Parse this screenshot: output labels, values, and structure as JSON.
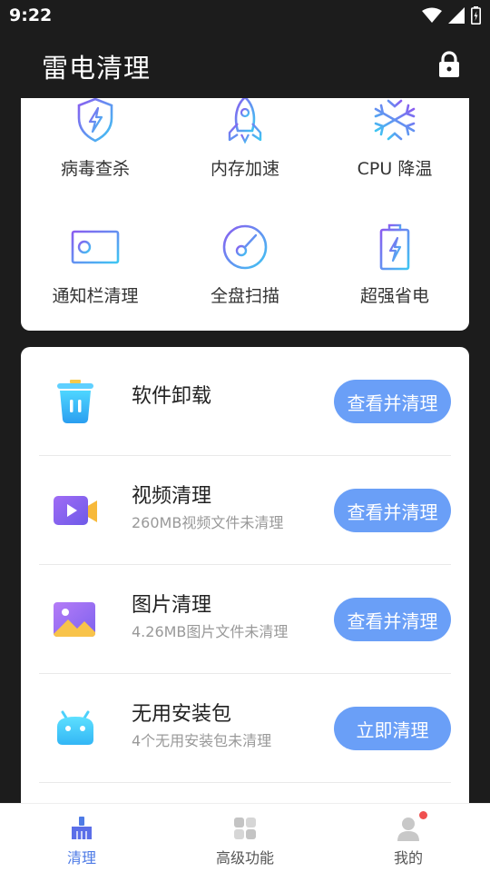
{
  "status_bar": {
    "time": "9:22"
  },
  "header": {
    "title": "雷电清理",
    "lock_icon": "lock-icon"
  },
  "grid": {
    "items": [
      {
        "label": "病毒查杀",
        "icon": "shield-lightning-icon"
      },
      {
        "label": "内存加速",
        "icon": "rocket-icon"
      },
      {
        "label": "CPU 降温",
        "icon": "snowflake-icon"
      },
      {
        "label": "通知栏清理",
        "icon": "id-card-icon"
      },
      {
        "label": "全盘扫描",
        "icon": "disc-scan-icon"
      },
      {
        "label": "超强省电",
        "icon": "battery-icon"
      }
    ]
  },
  "list": {
    "rows": [
      {
        "title": "软件卸载",
        "subtitle": "",
        "button": "查看并清理",
        "icon": "trash-icon"
      },
      {
        "title": "视频清理",
        "subtitle": "260MB视频文件未清理",
        "button": "查看并清理",
        "icon": "video-icon"
      },
      {
        "title": "图片清理",
        "subtitle": "4.26MB图片文件未清理",
        "button": "查看并清理",
        "icon": "image-icon"
      },
      {
        "title": "无用安装包",
        "subtitle": "4个无用安装包未清理",
        "button": "立即清理",
        "icon": "android-icon"
      }
    ]
  },
  "bottom_nav": {
    "items": [
      {
        "label": "清理",
        "active": true,
        "icon": "broom-icon"
      },
      {
        "label": "高级功能",
        "active": false,
        "icon": "grid-icon"
      },
      {
        "label": "我的",
        "active": false,
        "icon": "user-icon"
      }
    ]
  },
  "colors": {
    "accent": "#6a9ff7",
    "nav_active": "#4e7be6",
    "header_bg": "#1c1c1c"
  }
}
